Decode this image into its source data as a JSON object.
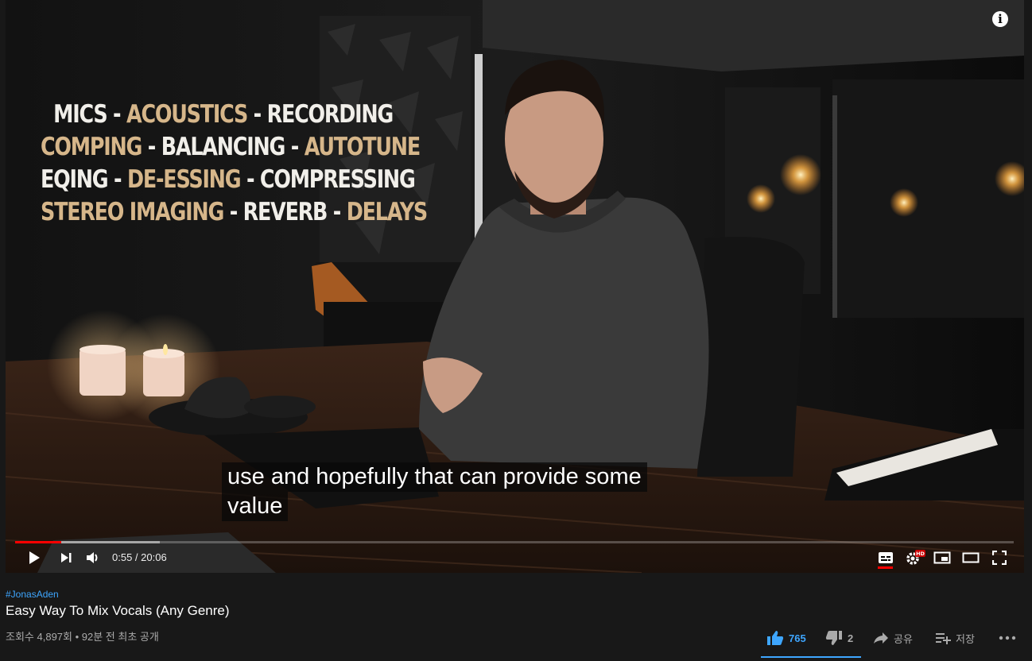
{
  "video": {
    "overlay_lines": [
      [
        {
          "t": "MICS - ",
          "c": "w-white"
        },
        {
          "t": "ACOUSTICS",
          "c": "w-gold"
        },
        {
          "t": " - RECORDING",
          "c": "w-white"
        }
      ],
      [
        {
          "t": "COMPING",
          "c": "w-gold"
        },
        {
          "t": " - BALANCING - ",
          "c": "w-white"
        },
        {
          "t": "AUTOTUNE",
          "c": "w-gold"
        }
      ],
      [
        {
          "t": "EQING - ",
          "c": "w-white"
        },
        {
          "t": "DE-ESSING",
          "c": "w-gold"
        },
        {
          "t": " - COMPRESSING",
          "c": "w-white"
        }
      ],
      [
        {
          "t": "STEREO IMAGING",
          "c": "w-gold"
        },
        {
          "t": " - REVERB - ",
          "c": "w-white"
        },
        {
          "t": "DELAYS",
          "c": "w-gold"
        }
      ]
    ],
    "captions": [
      "use and hopefully that can provide some",
      "value"
    ],
    "info_glyph": "i",
    "progress": {
      "played_fraction": 0.046,
      "loaded_fraction": 0.145
    },
    "time_display": "0:55 / 20:06",
    "hd_badge": "HD",
    "icons": {
      "play": "play-icon",
      "next": "next-icon",
      "volume": "volume-icon",
      "subtitles": "subtitles-icon",
      "settings": "settings-gear-icon",
      "miniplayer": "miniplayer-icon",
      "theater": "theater-mode-icon",
      "fullscreen": "fullscreen-icon"
    },
    "colors": {
      "progress_played": "#ff0000",
      "gold_text": "#d6b68a"
    }
  },
  "info": {
    "hashtag": "#JonasAden",
    "title": "Easy Way To Mix Vocals (Any Genre)",
    "meta": "조회수 4,897회 • 92분 전 최초 공개"
  },
  "actions": {
    "like_count": "765",
    "dislike_count": "2",
    "share_label": "공유",
    "save_label": "저장",
    "more_icon": "more-horizontal-icon",
    "accent": "#3ea6ff"
  }
}
